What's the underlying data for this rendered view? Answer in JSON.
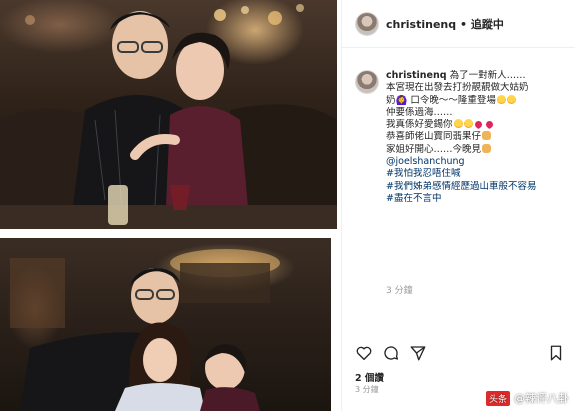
{
  "photos": {
    "top": {
      "label": ""
    },
    "bottom": {
      "label": ""
    }
  },
  "header": {
    "username": "christinenq",
    "separator": " • ",
    "follow_status": "追蹤中"
  },
  "caption": {
    "username": "christinenq",
    "lines": [
      "為了一對新人……",
      "本宮現在出發去打扮靚靚做大姑奶",
      "奶🙆‍♀️ 口令晚～～隆重登場",
      "仲要係過海……",
      "我真係好愛錫你",
      "恭喜師佬山寶同翡果仔",
      "家姐好開心……今晚見",
      "@joelshanchung",
      "#我怕我忍唔住喊",
      "#我們姊弟感情經歷過山車般不容易",
      "#盡在不言中"
    ],
    "time_ago": "3 分鐘"
  },
  "stats": {
    "likes": "2 個讚",
    "date": "3 分鐘"
  },
  "icons": {
    "like": "heart-icon",
    "comment": "comment-icon",
    "share": "share-icon",
    "save": "bookmark-icon"
  },
  "watermark": {
    "badge": "头条",
    "text": "@辣评八卦"
  },
  "colors": {
    "link": "#003569",
    "border": "#efefef",
    "muted": "#999999",
    "text": "#262626"
  }
}
